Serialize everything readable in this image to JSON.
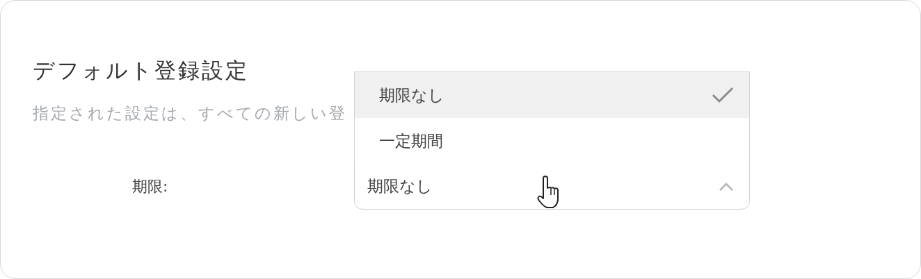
{
  "section": {
    "title": "デフォルト登録設定",
    "description": "指定された設定は、すべての新しい登"
  },
  "field": {
    "label": "期限:",
    "value": "期限なし",
    "expanded": true,
    "options": [
      {
        "label": "期限なし",
        "selected": true
      },
      {
        "label": "一定期間",
        "selected": false
      }
    ]
  }
}
